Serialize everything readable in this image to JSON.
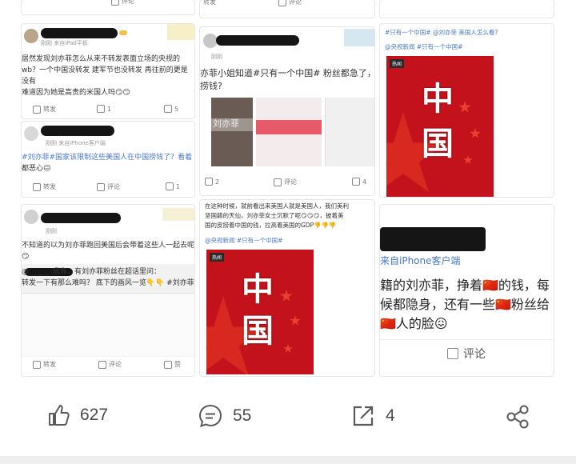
{
  "top_row": {
    "left_comment": "评论",
    "mid_forward": "转发",
    "mid_comment": "评论"
  },
  "post_a": {
    "meta": "刚刚 来自iPad平板",
    "text_lines": [
      "居然发现刘亦菲怎么从来不转发表面立场的央视的",
      "wb？一个中国没转发 建军节也没转发 再往前的更是",
      "没有",
      "难道因为她是高贵的米国人吗😏😏"
    ],
    "forward": "转发",
    "comment": "1",
    "like": "5"
  },
  "post_b": {
    "meta": "刚刚 来自iPhone客户端",
    "text_lines": [
      "#刘亦菲#国家该限制这些美国人在中国捞钱了？看着",
      "都恶心😖"
    ],
    "forward": "转发",
    "comment": "评论",
    "like": "1"
  },
  "post_c": {
    "meta": "刚刚",
    "text_lines": [
      "不知道的以为刘亦菲跑回美国后会带着这些人一起去呢",
      "😏"
    ],
    "quote_lines": [
      "@______:我靠，有刘亦菲粉丝在超话里问：",
      "转发一下有那么难吗？ 底下的画风一览👇👇 #刘亦菲#"
    ],
    "forward": "转发",
    "comment": "评论",
    "like": "赞"
  },
  "post_d": {
    "meta": "刚刚",
    "text_lines": [
      "亦菲小姐知道#只有一个中国# 粉丝都急了，怕",
      "捞钱?"
    ],
    "thumb_caption": "刘亦菲",
    "forward": "2",
    "comment": "评论",
    "like": "4"
  },
  "post_e": {
    "text_lines": [
      "在这种时候，就前看出来美国人就是美国人，我们美利",
      "坚国籍的天仙，刘亦菲女士沉默了呢😏😏😏，披着美",
      "国的皮捞着中国的钱，拉高着美国的GDP👎👎👎"
    ],
    "source": "@央视新闻 #只有一个中国#",
    "poster_tag": "热闻",
    "poster_text": "中国"
  },
  "post_f": {
    "text": "#只有一个中国# @刘亦菲 美国人怎么看?",
    "source": "@央视新闻 #只有一个中国#",
    "poster_tag": "热闻",
    "poster_text": "中国"
  },
  "post_g": {
    "meta": "来自iPhone客户端",
    "text_lines": [
      "籍的刘亦菲，挣着🇨🇳的钱，每",
      "候都隐身，还有一些🇨🇳粉丝给",
      "🇨🇳人的脸😖"
    ],
    "comment": "评论"
  },
  "bottom_bar": {
    "like_count": "627",
    "comment_count": "55",
    "share_count": "4"
  },
  "colors": {
    "accent_red": "#c4121c",
    "link_blue": "#4a78c8"
  }
}
